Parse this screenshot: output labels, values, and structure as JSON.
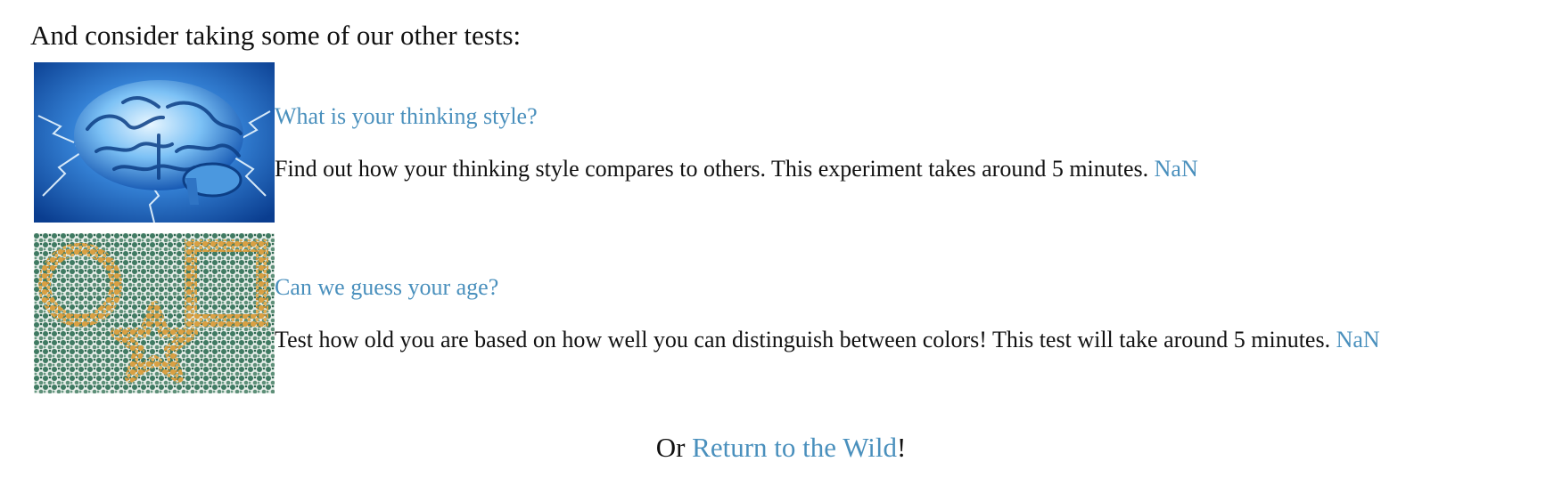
{
  "heading": "And consider taking some of our other tests:",
  "tests": [
    {
      "title": "What is your thinking style?",
      "description": "Find out how your thinking style compares to others. This experiment takes around 5 minutes.",
      "link": "NaN",
      "image_icon": "brain-lightning-image"
    },
    {
      "title": "Can we guess your age?",
      "description": "Test how old you are based on how well you can distinguish between colors! This test will take around 5 minutes.",
      "link": "NaN",
      "image_icon": "color-blindness-plate-image"
    }
  ],
  "footer": {
    "prefix": "Or ",
    "link": "Return to the Wild",
    "suffix": "!"
  },
  "colors": {
    "link": "#4a90bd",
    "text": "#111111",
    "plate_green": "#3f7a62",
    "plate_orange": "#d9a043",
    "brain_blue": "#1b6fd1"
  }
}
